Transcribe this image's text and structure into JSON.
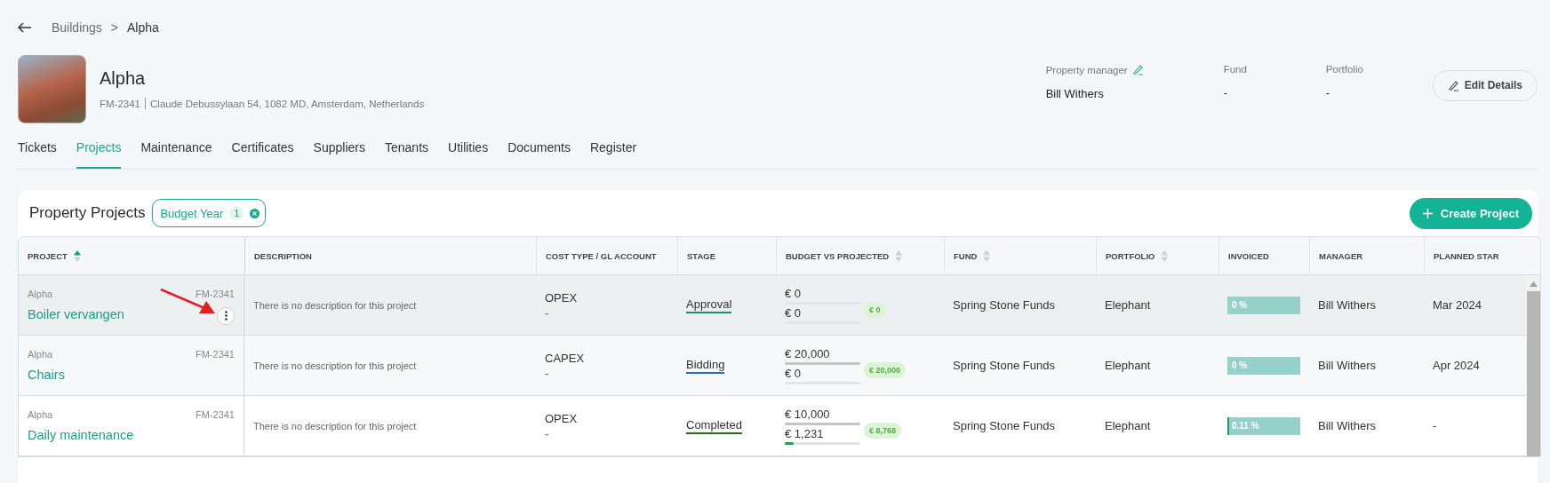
{
  "breadcrumb": {
    "items": [
      "Buildings",
      "Alpha"
    ],
    "separator": ">"
  },
  "building": {
    "name": "Alpha",
    "code": "FM-2341",
    "address": "Claude Debussylaan 54, 1082 MD, Amsterdam, Netherlands"
  },
  "details": [
    {
      "label": "Property manager",
      "value": "Bill Withers",
      "editable": true
    },
    {
      "label": "Fund",
      "value": "-",
      "editable": false
    },
    {
      "label": "Portfolio",
      "value": "-",
      "editable": false
    }
  ],
  "edit_button": "Edit Details",
  "tabs": [
    {
      "label": "Tickets",
      "selected": false
    },
    {
      "label": "Projects",
      "selected": true
    },
    {
      "label": "Maintenance",
      "selected": false
    },
    {
      "label": "Certificates",
      "selected": false
    },
    {
      "label": "Suppliers",
      "selected": false
    },
    {
      "label": "Tenants",
      "selected": false
    },
    {
      "label": "Utilities",
      "selected": false
    },
    {
      "label": "Documents",
      "selected": false
    },
    {
      "label": "Register",
      "selected": false
    }
  ],
  "section": {
    "title": "Property Projects",
    "filter": {
      "label": "Budget Year",
      "count": "1"
    },
    "create_button": "Create Project"
  },
  "table": {
    "columns": [
      {
        "label": "PROJECT",
        "sortable": true,
        "sorted_ascending": true
      },
      {
        "label": "DESCRIPTION",
        "sortable": false
      },
      {
        "label": "COST TYPE / GL ACCOUNT",
        "sortable": false
      },
      {
        "label": "STAGE",
        "sortable": false
      },
      {
        "label": "BUDGET VS PROJECTED",
        "sortable": true,
        "sorted_ascending": false
      },
      {
        "label": "FUND",
        "sortable": true,
        "sorted_ascending": false
      },
      {
        "label": "PORTFOLIO",
        "sortable": true,
        "sorted_ascending": false
      },
      {
        "label": "INVOICED",
        "sortable": false
      },
      {
        "label": "MANAGER",
        "sortable": false
      },
      {
        "label": "PLANNED STAR",
        "sortable": false
      }
    ],
    "rows": [
      {
        "building": "Alpha",
        "code": "FM-2341",
        "name": "Boiler vervangen",
        "highlighted": true,
        "pointer_arrow": true,
        "description": "There is no description for this project",
        "cost_type": "OPEX",
        "gl_account": "-",
        "stage": {
          "label": "Approval",
          "color": "#1d8b74"
        },
        "budget": {
          "amount": "€ 0",
          "level": 0
        },
        "projected": {
          "amount": "€ 0",
          "level": 0
        },
        "difference": "€ 0",
        "fund": "Spring Stone Funds",
        "portfolio": "Elephant",
        "invoiced": {
          "reading": "0 %",
          "level": 0
        },
        "manager": "Bill Withers",
        "planned_start": "Mar 2024"
      },
      {
        "building": "Alpha",
        "code": "FM-2341",
        "name": "Chairs",
        "highlighted": false,
        "pointer_arrow": false,
        "description": "There is no description for this project",
        "cost_type": "CAPEX",
        "gl_account": "-",
        "stage": {
          "label": "Bidding",
          "color": "#1f6fc4"
        },
        "budget": {
          "amount": "€ 20,000",
          "level": 1
        },
        "projected": {
          "amount": "€ 0",
          "level": 0
        },
        "difference": "€ 20,000",
        "fund": "Spring Stone Funds",
        "portfolio": "Elephant",
        "invoiced": {
          "reading": "0 %",
          "level": 0
        },
        "manager": "Bill Withers",
        "planned_start": "Apr 2024"
      },
      {
        "building": "Alpha",
        "code": "FM-2341",
        "name": "Daily maintenance",
        "highlighted": false,
        "pointer_arrow": false,
        "description": "There is no description for this project",
        "cost_type": "OPEX",
        "gl_account": "-",
        "stage": {
          "label": "Completed",
          "color": "#2e6b1e"
        },
        "budget": {
          "amount": "€ 10,000",
          "level": 1
        },
        "projected": {
          "amount": "€ 1,231",
          "level": 0.12
        },
        "difference": "€ 8,768",
        "fund": "Spring Stone Funds",
        "portfolio": "Elephant",
        "invoiced": {
          "reading": "0.11 %",
          "level": 0.0011
        },
        "manager": "Bill Withers",
        "planned_start": "-"
      }
    ]
  }
}
